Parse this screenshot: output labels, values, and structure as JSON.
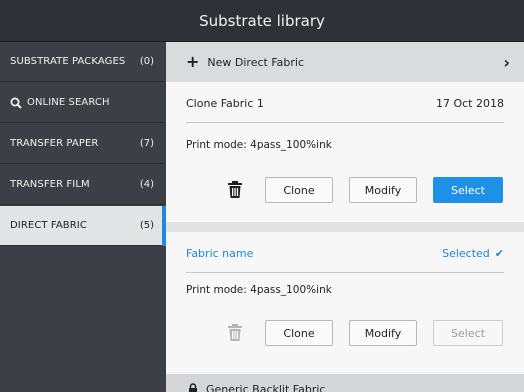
{
  "header": {
    "title": "Substrate library"
  },
  "sidebar": {
    "items": [
      {
        "label": "SUBSTRATE PACKAGES",
        "count": "(0)"
      },
      {
        "label": "ONLINE SEARCH",
        "count": ""
      },
      {
        "label": "TRANSFER PAPER",
        "count": "(7)"
      },
      {
        "label": "TRANSFER FILM",
        "count": "(4)"
      },
      {
        "label": "DIRECT FABRIC",
        "count": "(5)",
        "active": true
      }
    ]
  },
  "main": {
    "new_item_label": "New Direct Fabric",
    "cards": [
      {
        "name": "Clone Fabric 1",
        "date": "17 Oct 2018",
        "print_mode_label": "Print mode:",
        "print_mode_value": "4pass_100%ink",
        "clone_label": "Clone",
        "modify_label": "Modify",
        "select_label": "Select"
      },
      {
        "name": "Fabric name",
        "status": "Selected",
        "print_mode_label": "Print mode:",
        "print_mode_value": "4pass_100%ink",
        "clone_label": "Clone",
        "modify_label": "Modify",
        "select_label": "Select"
      }
    ],
    "next_item_label": "Generic Backlit Fabric"
  },
  "colors": {
    "accent": "#1e90e8",
    "selected_text": "#1d86d6",
    "sidebar_bg": "#3c3f45",
    "titlebar_bg": "#2e3136"
  },
  "icons": [
    "search-icon",
    "plus-icon",
    "chevron-right-icon",
    "trash-icon",
    "check-icon",
    "lock-icon"
  ]
}
